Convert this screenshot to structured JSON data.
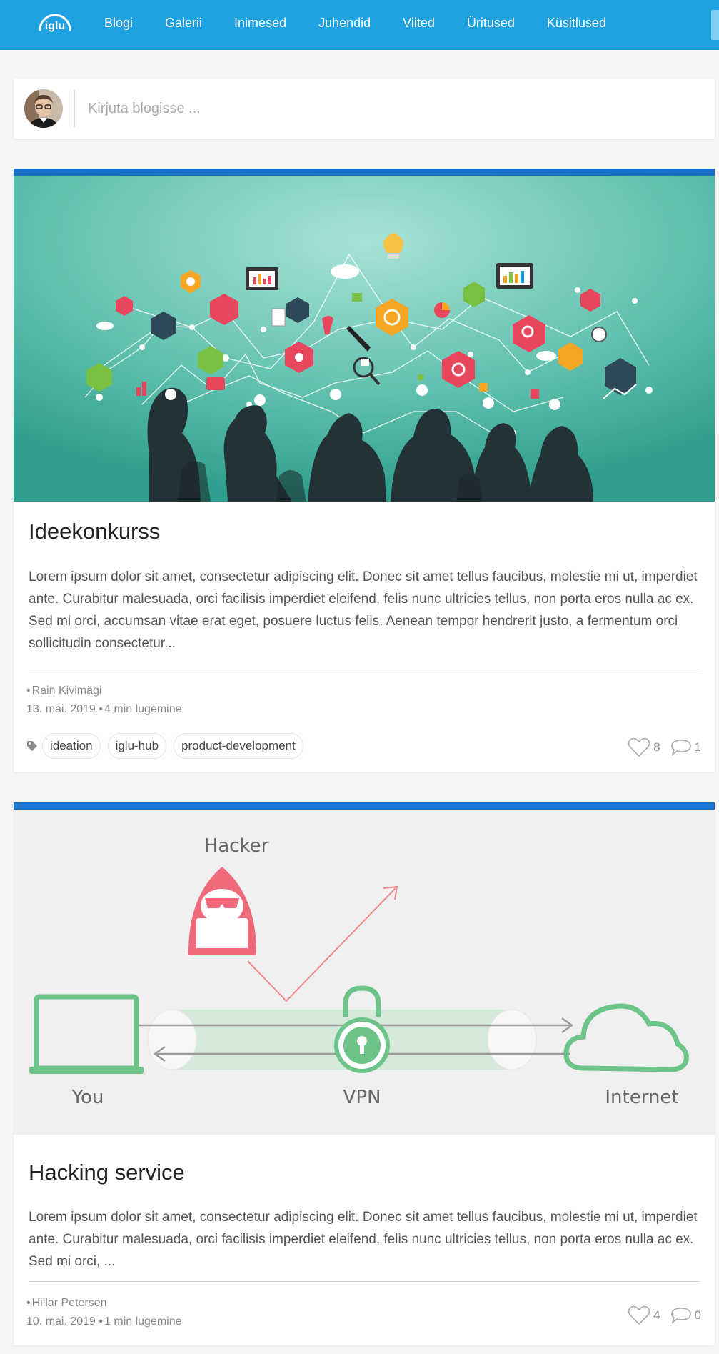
{
  "nav": {
    "logo_text": "iglu",
    "items": [
      "Blogi",
      "Galerii",
      "Inimesed",
      "Juhendid",
      "Viited",
      "Üritused",
      "Küsitlused"
    ]
  },
  "composer": {
    "placeholder": "Kirjuta blogisse ..."
  },
  "posts": [
    {
      "title": "Ideekonkurss",
      "excerpt": "Lorem ipsum dolor sit amet, consectetur adipiscing elit. Donec sit amet tellus faucibus, molestie mi ut, imperdiet ante. Curabitur malesuada, orci facilisis imperdiet eleifend, felis nunc ultricies tellus, non porta eros nulla ac ex. Sed mi orci, accumsan vitae erat eget, posuere luctus felis. Aenean tempor hendrerit justo, a fermentum orci sollicitudin consectetur...",
      "author": "Rain Kivimägi",
      "date": "13. mai. 2019",
      "read_time": "4 min lugemine",
      "tags": [
        "ideation",
        "iglu-hub",
        "product-development"
      ],
      "likes": "8",
      "comments": "1"
    },
    {
      "title": "Hacking service",
      "excerpt": "Lorem ipsum dolor sit amet, consectetur adipiscing elit. Donec sit amet tellus faucibus, molestie mi ut, imperdiet ante. Curabitur malesuada, orci facilisis imperdiet eleifend, felis nunc ultricies tellus, non porta eros nulla ac ex. Sed mi orci, ...",
      "author": "Hillar Petersen",
      "date": "10. mai. 2019",
      "read_time": "1 min lugemine",
      "likes": "4",
      "comments": "0",
      "image_labels": {
        "hacker": "Hacker",
        "you": "You",
        "vpn": "VPN",
        "internet": "Internet"
      }
    }
  ],
  "colors": {
    "nav_bg": "#1da1e0",
    "card_accent": "#1a6fc6",
    "hero1_bg": "#5fbfae",
    "vpn_green": "#6cc488",
    "hacker_red": "#ef6b7b"
  }
}
